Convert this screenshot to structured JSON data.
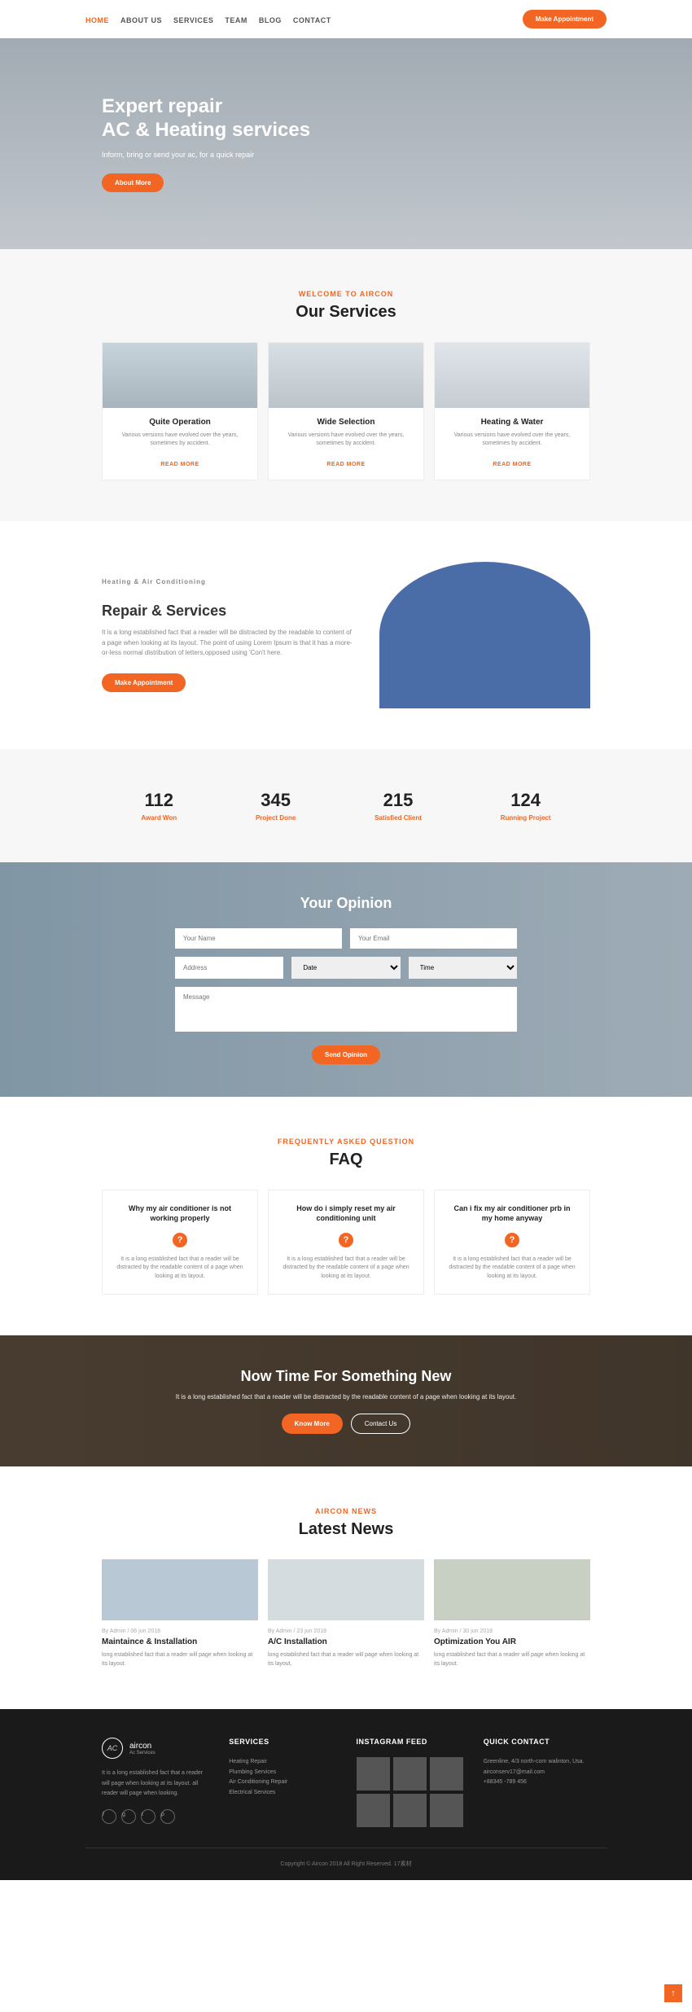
{
  "nav": {
    "items": [
      "HOME",
      "ABOUT US",
      "SERVICES",
      "TEAM",
      "BLOG",
      "CONTACT"
    ],
    "cta": "Make Appointment"
  },
  "hero": {
    "title1": "Expert repair",
    "title2": "AC & Heating services",
    "subtitle": "Inform, bring or send your ac, for a quick repair",
    "button": "About More"
  },
  "services": {
    "label": "WELCOME TO AIRCON",
    "title": "Our Services",
    "items": [
      {
        "title": "Quite Operation",
        "text": "Various versions have evolved over the years, sometimes by accident.",
        "link": "READ MORE"
      },
      {
        "title": "Wide Selection",
        "text": "Various versions have evolved over the years, sometimes by accident.",
        "link": "READ MORE"
      },
      {
        "title": "Heating & Water",
        "text": "Various versions have evolved over the years, sometimes by accident.",
        "link": "READ MORE"
      }
    ]
  },
  "repair": {
    "label": "Heating & Air Conditioning",
    "title": "Repair & Services",
    "text": "It is a long established fact that a reader will be distracted by the readable to content of a page when looking at its layout. The point of using Lorem Ipsum is that it has a more-or-less normal distribution of letters,opposed using 'Con't here.",
    "button": "Make Appointment"
  },
  "stats": [
    {
      "num": "112",
      "label": "Award Won"
    },
    {
      "num": "345",
      "label": "Project Done"
    },
    {
      "num": "215",
      "label": "Satisfied Client"
    },
    {
      "num": "124",
      "label": "Running Project"
    }
  ],
  "opinion": {
    "title": "Your Opinion",
    "name_ph": "Your Name",
    "email_ph": "Your Email",
    "address_ph": "Address",
    "date_ph": "Date",
    "time_ph": "Time",
    "message_ph": "Message",
    "submit": "Send Opinion"
  },
  "faq": {
    "label": "FREQUENTLY ASKED QUESTION",
    "title": "FAQ",
    "items": [
      {
        "q": "Why my air conditioner is not working properly",
        "a": "It is a long established fact that a reader will be distracted by the readable content of a page when looking at its layout."
      },
      {
        "q": "How do i simply reset my air conditioning unit",
        "a": "It is a long established fact that a reader will be distracted by the readable content of a page when looking at its layout."
      },
      {
        "q": "Can i fix my air conditioner prb in my home anyway",
        "a": "It is a long established fact that a reader will be distracted by the readable content of a page when looking at its layout."
      }
    ]
  },
  "cta": {
    "title": "Now Time For Something New",
    "text": "It is a long established fact that a reader will be distracted by the readable content of a page when looking at its layout.",
    "btn1": "Know More",
    "btn2": "Contact Us"
  },
  "news": {
    "label": "AIRCON NEWS",
    "title": "Latest News",
    "items": [
      {
        "meta": "By Admin / 06 jun 2018",
        "title": "Maintaince & Installation",
        "text": "long established fact that a reader will page when looking at its layout."
      },
      {
        "meta": "By Admin / 23 jun 2018",
        "title": "A/C Installation",
        "text": "long established fact that a reader will page when looking at its layout."
      },
      {
        "meta": "By Admin / 30 jun 2018",
        "title": "Optimization You AIR",
        "text": "long established fact that a reader will page when looking at its layout."
      }
    ]
  },
  "footer": {
    "brand": "aircon",
    "brand_sub": "Ac Services",
    "about": "It is a long established fact that a reader will page when looking at its layout. all reader will page when looking.",
    "services_h": "SERVICES",
    "services": [
      "Heating Repair",
      "Plumbing Services",
      "Air Conditioning Repair",
      "Electrical Services"
    ],
    "instagram_h": "INSTAGRAM FEED",
    "contact_h": "QUICK CONTACT",
    "address": "Greenline, 4/3 north-corn walinton, Usa.",
    "email": "airconserv17@mail.com",
    "phone": "+88345 -789 456",
    "copyright": "Copyright © Aircon 2018 All Right Reserved. 17素材"
  }
}
